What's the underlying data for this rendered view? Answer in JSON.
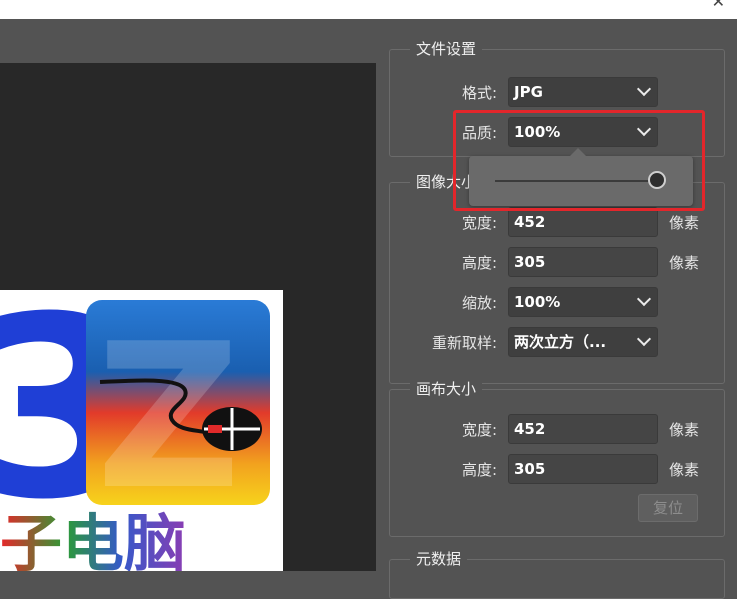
{
  "file_settings": {
    "title": "文件设置",
    "format_label": "格式:",
    "format_value": "JPG",
    "quality_label": "品质:",
    "quality_value": "100%"
  },
  "quality_slider": {
    "value_percent": 100
  },
  "image_size": {
    "title": "图像大小",
    "width_label": "宽度:",
    "width_value": "452",
    "width_unit": "像素",
    "height_label": "高度:",
    "height_value": "305",
    "height_unit": "像素",
    "scale_label": "缩放:",
    "scale_value": "100%",
    "resample_label": "重新取样:",
    "resample_value": "两次立方（..."
  },
  "canvas_size": {
    "title": "画布大小",
    "width_label": "宽度:",
    "width_value": "452",
    "width_unit": "像素",
    "height_label": "高度:",
    "height_value": "305",
    "height_unit": "像素",
    "reset_label": "复位"
  },
  "metadata": {
    "title": "元数据"
  },
  "preview_logo": {
    "number_text": "3",
    "letter_text": "Z",
    "bottom_text": "子电脑"
  },
  "colors": {
    "accent_highlight": "#e3262b",
    "panel_bg": "#535353"
  }
}
